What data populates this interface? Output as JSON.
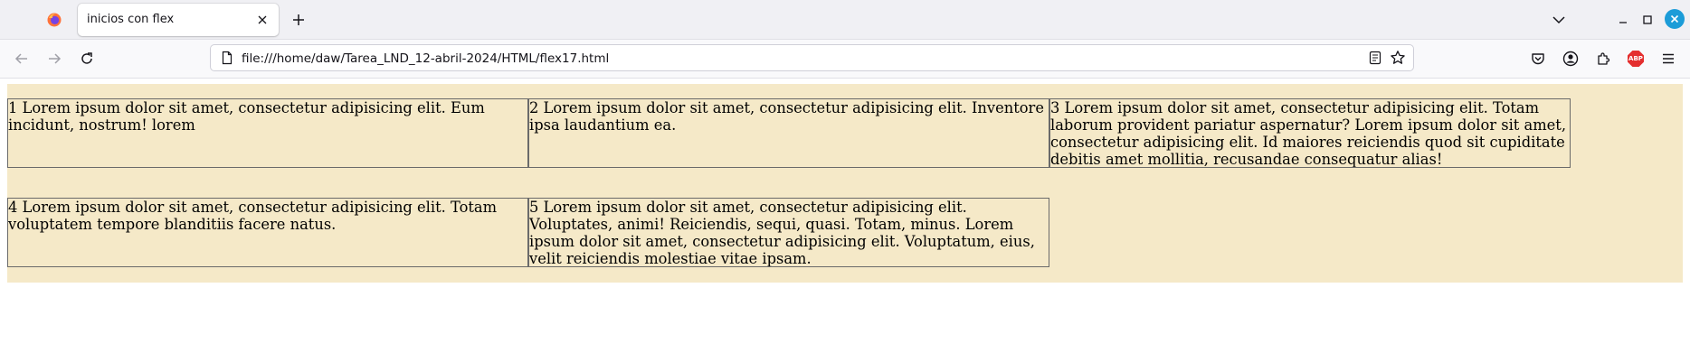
{
  "browser": {
    "tab": {
      "title": "inicios con flex"
    },
    "url": "file:///home/daw/Tarea_LND_12-abril-2024/HTML/flex17.html"
  },
  "page": {
    "items": [
      {
        "text": "1 Lorem ipsum dolor sit amet, consectetur adipisicing elit. Eum incidunt, nostrum! lorem"
      },
      {
        "text": "2 Lorem ipsum dolor sit amet, consectetur adipisicing elit. Inventore ipsa laudantium ea."
      },
      {
        "text": "3 Lorem ipsum dolor sit amet, consectetur adipisicing elit. Totam laborum provident pariatur aspernatur? Lorem ipsum dolor sit amet, consectetur adipisicing elit. Id maiores reiciendis quod sit cupiditate debitis amet mollitia, recusandae consequatur alias!"
      },
      {
        "text": "4 Lorem ipsum dolor sit amet, consectetur adipisicing elit. Totam voluptatem tempore blanditiis facere natus."
      },
      {
        "text": "5 Lorem ipsum dolor sit amet, consectetur adipisicing elit. Voluptates, animi! Reiciendis, sequi, quasi. Totam, minus. Lorem ipsum dolor sit amet, consectetur adipisicing elit. Voluptatum, eius, velit reiciendis molestiae vitae ipsam."
      }
    ]
  },
  "colors": {
    "container_bg": "#f5e9c8",
    "item_border": "#6a6a6a",
    "abp_red": "#e42e2e",
    "window_close_blue": "#1c9cd8"
  },
  "icons": [
    "firefox-icon",
    "close-tab-icon",
    "new-tab-icon",
    "list-all-tabs-icon",
    "minimize-icon",
    "maximize-icon",
    "window-close-icon",
    "back-icon",
    "forward-icon",
    "reload-icon",
    "page-icon",
    "reader-view-icon",
    "bookmark-star-icon",
    "pocket-icon",
    "account-icon",
    "extensions-icon",
    "adblock-plus-icon",
    "menu-icon"
  ]
}
